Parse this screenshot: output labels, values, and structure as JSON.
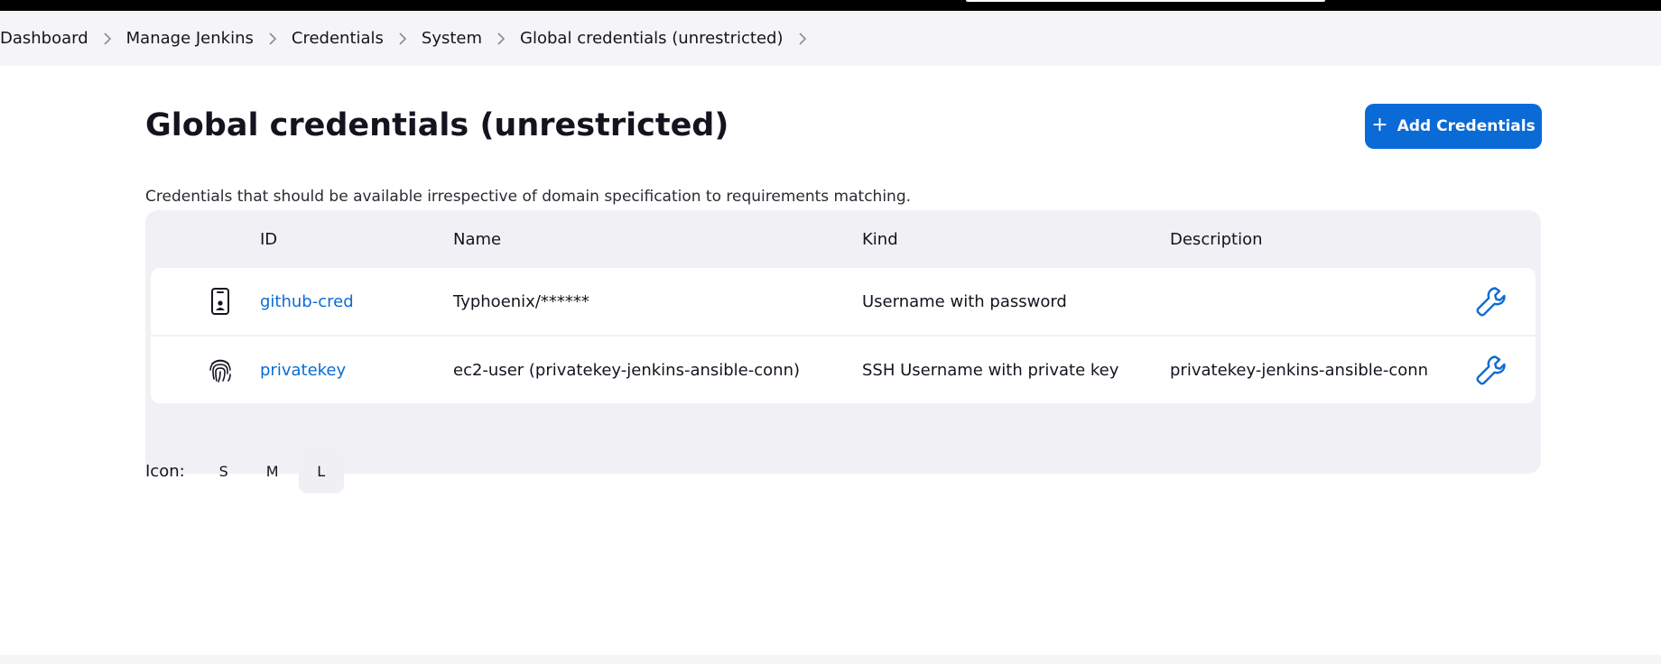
{
  "breadcrumbs": [
    "Dashboard",
    "Manage Jenkins",
    "Credentials",
    "System",
    "Global credentials (unrestricted)"
  ],
  "page": {
    "title": "Global credentials (unrestricted)",
    "add_button": "Add Credentials",
    "description": "Credentials that should be available irrespective of domain specification to requirements matching."
  },
  "table": {
    "headers": {
      "id": "ID",
      "name": "Name",
      "kind": "Kind",
      "description": "Description"
    },
    "rows": [
      {
        "icon": "phone-id-icon",
        "id": "github-cred",
        "name": "Typhoenix/******",
        "kind": "Username with password",
        "description": ""
      },
      {
        "icon": "fingerprint-icon",
        "id": "privatekey",
        "name": "ec2-user (privatekey-jenkins-ansible-conn)",
        "kind": "SSH Username with private key",
        "description": "privatekey-jenkins-ansible-conn"
      }
    ]
  },
  "icon_size": {
    "label": "Icon:",
    "options": [
      "S",
      "M",
      "L"
    ],
    "selected": "L"
  },
  "colors": {
    "accent": "#0b6bd6",
    "breadcrumb_bg": "#f5f5f7",
    "table_bg": "#f1f1f5"
  }
}
